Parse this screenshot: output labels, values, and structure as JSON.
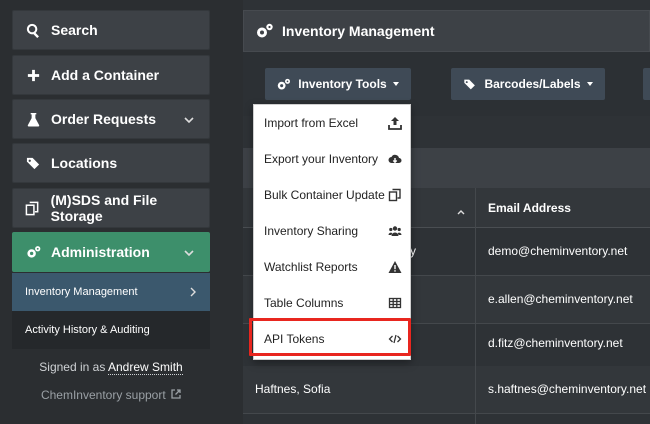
{
  "sidebar": {
    "items": [
      {
        "label": "Search",
        "icon": "search-icon"
      },
      {
        "label": "Add a Container",
        "icon": "plus-icon"
      },
      {
        "label": "Order Requests",
        "icon": "flask-icon"
      },
      {
        "label": "Locations",
        "icon": "tags-icon"
      },
      {
        "label": "(M)SDS and File Storage",
        "icon": "copy-icon"
      },
      {
        "label": "Administration",
        "icon": "cogs-icon"
      }
    ],
    "sub_items": [
      {
        "label": "Inventory Management"
      },
      {
        "label": "Activity History & Auditing"
      }
    ],
    "signed_in_prefix": "Signed in as",
    "signed_in_name": "Andrew Smith",
    "support_label": "ChemInventory support"
  },
  "main": {
    "title": "Inventory Management",
    "toolbar": {
      "inventory_tools": "Inventory Tools",
      "barcodes": "Barcodes/Labels"
    },
    "table": {
      "email_header": "Email Address",
      "rows": [
        {
          "name": "",
          "trail": "y",
          "email": "demo@cheminventory.net"
        },
        {
          "name": "",
          "trail": "",
          "email": "e.allen@cheminventory.net"
        },
        {
          "name": "",
          "trail": "",
          "email": "d.fitz@cheminventory.net"
        },
        {
          "name": "Haftnes, Sofia",
          "trail": "",
          "email": "s.haftnes@cheminventory.net"
        }
      ]
    }
  },
  "dropdown": {
    "items": [
      {
        "label": "Import from Excel",
        "icon": "upload-icon"
      },
      {
        "label": "Export your Inventory",
        "icon": "cloud-download-icon"
      },
      {
        "label": "Bulk Container Update",
        "icon": "copy-icon"
      },
      {
        "label": "Inventory Sharing",
        "icon": "users-icon"
      },
      {
        "label": "Watchlist Reports",
        "icon": "warning-icon"
      },
      {
        "label": "Table Columns",
        "icon": "table-icon"
      },
      {
        "label": "API Tokens",
        "icon": "code-icon"
      }
    ]
  },
  "colors": {
    "accent_green": "#3d8f6b",
    "selected_blue": "#3b586d",
    "highlight_red": "#e8261f"
  }
}
